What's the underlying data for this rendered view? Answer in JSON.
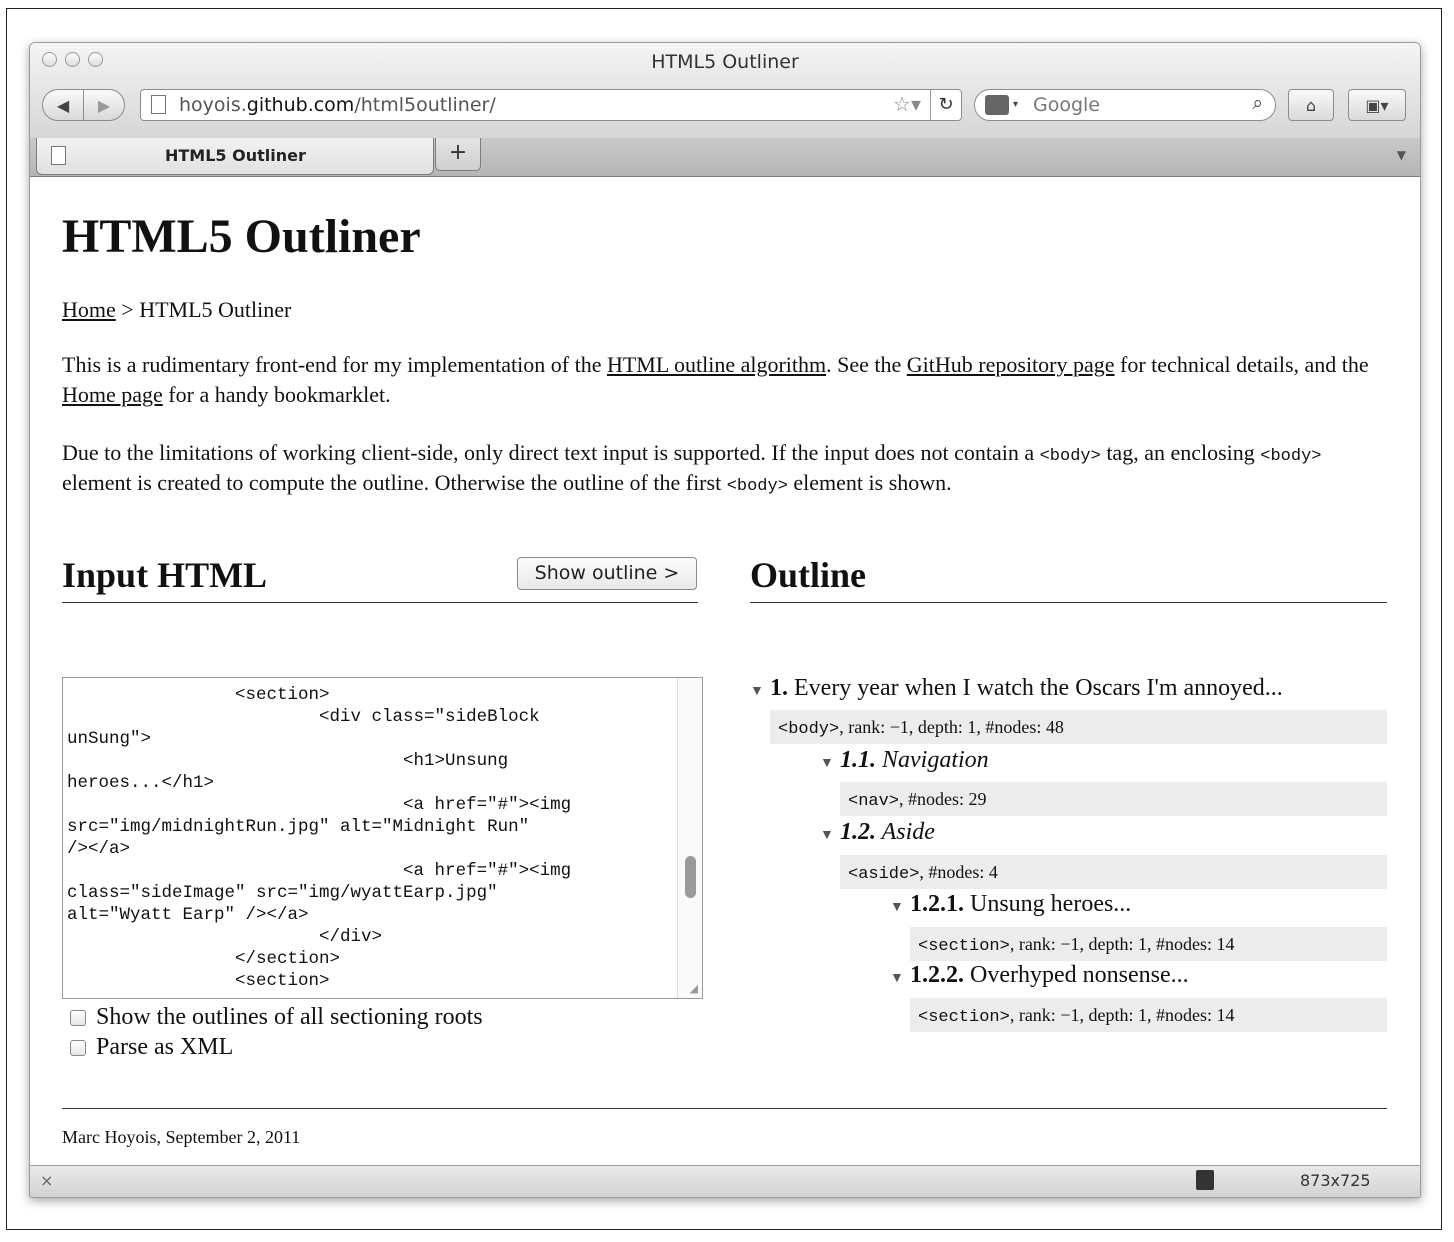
{
  "window": {
    "title": "HTML5 Outliner"
  },
  "toolbar": {
    "url_prefix": "hoyois.",
    "url_domain": "github.com",
    "url_path": "/html5outliner/",
    "search_placeholder": "Google"
  },
  "tabs": [
    {
      "label": "HTML5 Outliner"
    }
  ],
  "page": {
    "title": "HTML5 Outliner",
    "breadcrumb": {
      "home": "Home",
      "separator": " > ",
      "current": "HTML5 Outliner"
    },
    "intro": {
      "p1": "This is a rudimentary front-end for my implementation of the ",
      "link1": "HTML outline algorithm",
      "p2": ". See the ",
      "link2": "GitHub repository page",
      "p3": " for technical details, and the ",
      "link3": "Home page",
      "p4": " for a handy bookmarklet."
    },
    "note": {
      "p1": "Due to the limitations of working client-side, only direct text input is supported. If the input does not contain a ",
      "tag1": "<body>",
      "p2": " tag, an enclosing ",
      "tag2": "<body>",
      "p3": " element is created to compute the outline. Otherwise the outline of the first ",
      "tag3": "<body>",
      "p4": " element is shown."
    },
    "input_heading": "Input HTML",
    "show_outline_button": "Show outline >",
    "outline_heading": "Outline",
    "code_lines": [
      "                <section>",
      "                        <div class=\"sideBlock",
      "unSung\">",
      "                                <h1>Unsung",
      "heroes...</h1>",
      "                                <a href=\"#\"><img",
      "src=\"img/midnightRun.jpg\" alt=\"Midnight Run\"",
      "/></a>",
      "                                <a href=\"#\"><img",
      "class=\"sideImage\" src=\"img/wyattEarp.jpg\"",
      "alt=\"Wyatt Earp\" /></a>",
      "                        </div>",
      "                </section>",
      "                <section>"
    ],
    "checkboxes": [
      {
        "label": "Show the outlines of all sectioning roots",
        "checked": false
      },
      {
        "label": "Parse as XML",
        "checked": false
      }
    ],
    "outline": [
      {
        "num": "1.",
        "text": "Every year when I watch the Oscars I'm annoyed...",
        "italic": false,
        "meta_tag": "<body>",
        "meta": ", rank: −1, depth: 1, #nodes: 48"
      },
      {
        "num": "1.1.",
        "text": "Navigation",
        "italic": true,
        "meta_tag": "<nav>",
        "meta": ", #nodes: 29"
      },
      {
        "num": "1.2.",
        "text": "Aside",
        "italic": true,
        "meta_tag": "<aside>",
        "meta": ", #nodes: 4"
      },
      {
        "num": "1.2.1.",
        "text": "Unsung heroes...",
        "italic": false,
        "meta_tag": "<section>",
        "meta": ", rank: −1, depth: 1, #nodes: 14"
      },
      {
        "num": "1.2.2.",
        "text": "Overhyped nonsense...",
        "italic": false,
        "meta_tag": "<section>",
        "meta": ", rank: −1, depth: 1, #nodes: 14"
      }
    ],
    "footer": "Marc Hoyois, September 2, 2011"
  },
  "statusbar": {
    "close": "×",
    "size": "873x725"
  }
}
